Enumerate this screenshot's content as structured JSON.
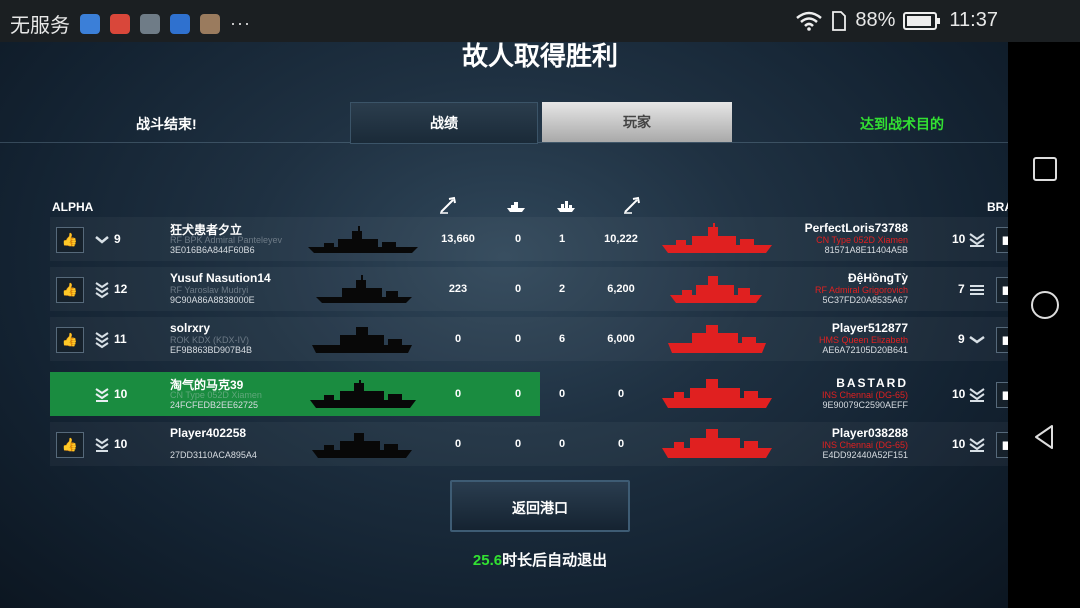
{
  "status_bar": {
    "carrier": "无服务",
    "battery_pct": "88%",
    "time": "11:37",
    "more": "···"
  },
  "screen": {
    "title": "故人取得胜利",
    "battle_over": "战斗结束!",
    "tabs": [
      {
        "label": "战绩"
      },
      {
        "label": "玩家"
      }
    ],
    "objective": "达到战术目的",
    "team_left": "ALPHA",
    "team_right": "BRA",
    "colors": {
      "highlight": "#1a8c40",
      "objective": "#32e032",
      "enemy_ship": "#e02020"
    }
  },
  "players": [
    {
      "level": "9",
      "name": "狂犬患者夕立",
      "ship": "RF BPK Admiral Panteleyev",
      "id": "3E016B6A844F60B6",
      "stats": [
        "13,660",
        "0",
        "1",
        "10,222"
      ],
      "enemy": {
        "name": "PerfectLoris73788",
        "ship": "CN Type 052D Xiamen",
        "id": "81571A8E11404A5B",
        "level": "10"
      }
    },
    {
      "level": "12",
      "name": "Yusuf Nasution14",
      "ship": "RF Yaroslav Mudryi",
      "id": "9C90A86A8838000E",
      "stats": [
        "223",
        "0",
        "2",
        "6,200"
      ],
      "enemy": {
        "name": "ĐệHồngTỳ",
        "ship": "RF Admiral Grigorovich",
        "id": "5C37FD20A8535A67",
        "level": "7"
      }
    },
    {
      "level": "11",
      "name": "solrxry",
      "ship": "ROK KDX (KDX-IV)",
      "id": "EF9B863BD907B4B",
      "stats": [
        "0",
        "0",
        "6",
        "6,000"
      ],
      "enemy": {
        "name": "Player512877",
        "ship": "HMS Queen Elizabeth",
        "id": "AE6A72105D20B641",
        "level": "9"
      }
    },
    {
      "level": "10",
      "name": "淘气的马克39",
      "ship": "CN Type 052D Xiamen",
      "id": "24FCFEDB2EE62725",
      "stats": [
        "0",
        "0",
        "0",
        "0"
      ],
      "enemy": {
        "name": "BASTARD",
        "ship": "INS Chennai (DG-65)",
        "id": "9E90079C2590AEFF",
        "level": "10"
      }
    },
    {
      "level": "10",
      "name": "Player402258",
      "ship": "",
      "id": "27DD3110ACA895A4",
      "stats": [
        "0",
        "0",
        "0",
        "0"
      ],
      "enemy": {
        "name": "Player038288",
        "ship": "INS Chennai (DG-65)",
        "id": "E4DD92440A52F151",
        "level": "10"
      }
    }
  ],
  "return_button": "返回港口",
  "auto_exit": {
    "countdown": "25.6",
    "text": "时长后自动退出"
  }
}
